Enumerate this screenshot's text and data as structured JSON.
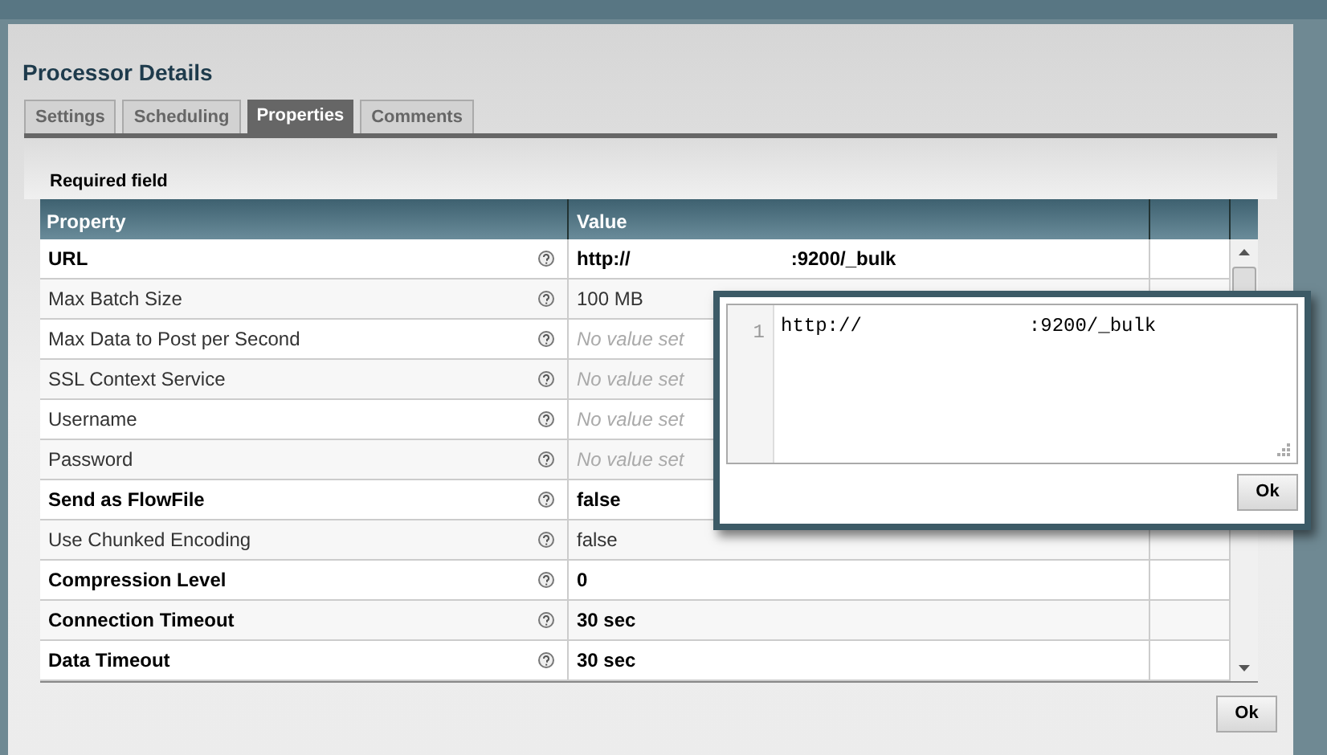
{
  "dialog": {
    "title": "Processor Details",
    "tabs": [
      {
        "label": "Settings",
        "selected": false
      },
      {
        "label": "Scheduling",
        "selected": false
      },
      {
        "label": "Properties",
        "selected": true
      },
      {
        "label": "Comments",
        "selected": false
      }
    ],
    "note": "Required field",
    "table": {
      "columns": [
        "Property",
        "Value"
      ],
      "rows": [
        {
          "name": "URL",
          "required": true,
          "value_set": true,
          "value": "http://",
          "value_end": ":9200/_bulk"
        },
        {
          "name": "Max Batch Size",
          "required": false,
          "value_set": true,
          "value": "100 MB"
        },
        {
          "name": "Max Data to Post per Second",
          "required": false,
          "value_set": false,
          "value": "No value set"
        },
        {
          "name": "SSL Context Service",
          "required": false,
          "value_set": false,
          "value": "No value set"
        },
        {
          "name": "Username",
          "required": false,
          "value_set": false,
          "value": "No value set"
        },
        {
          "name": "Password",
          "required": false,
          "value_set": false,
          "value": "No value set"
        },
        {
          "name": "Send as FlowFile",
          "required": true,
          "value_set": true,
          "value": "false"
        },
        {
          "name": "Use Chunked Encoding",
          "required": false,
          "value_set": true,
          "value": "false"
        },
        {
          "name": "Compression Level",
          "required": true,
          "value_set": true,
          "value": "0"
        },
        {
          "name": "Connection Timeout",
          "required": true,
          "value_set": true,
          "value": "30 sec"
        },
        {
          "name": "Data Timeout",
          "required": true,
          "value_set": true,
          "value": "30 sec"
        }
      ]
    },
    "ok_button": "Ok"
  },
  "editor": {
    "line_number": "1",
    "text": "http://",
    "text_end": ":9200/_bulk",
    "ok_button": "Ok"
  }
}
